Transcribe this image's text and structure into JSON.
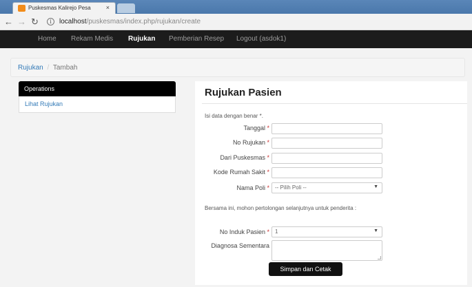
{
  "browser": {
    "tab_title": "Puskesmas Kalirejo Pesa",
    "tab_close": "×",
    "url_info": "i",
    "url_host": "localhost",
    "url_path": "/puskesmas/index.php/rujukan/create"
  },
  "navbar": {
    "items": [
      {
        "label": "Home"
      },
      {
        "label": "Rekam Medis"
      },
      {
        "label": "Rujukan",
        "active": true
      },
      {
        "label": "Pemberian Resep"
      },
      {
        "label": "Logout (asdok1)"
      }
    ]
  },
  "breadcrumb": {
    "link": "Rujukan",
    "separator": "/",
    "current": "Tambah"
  },
  "sidebar": {
    "heading": "Operations",
    "items": [
      {
        "label": "Lihat Rujukan"
      }
    ]
  },
  "form": {
    "title": "Rujukan Pasien",
    "required_note": "Isi data dengan benar *.",
    "required_mark": "*",
    "fields": {
      "tanggal": {
        "label": "Tanggal",
        "value": ""
      },
      "no_rujukan": {
        "label": "No Rujukan",
        "value": ""
      },
      "dari_puskesmas": {
        "label": "Dari Puskesmas",
        "value": ""
      },
      "kode_rumah_sakit": {
        "label": "Kode Rumah Sakit",
        "value": ""
      },
      "nama_poli": {
        "label": "Nama Poli",
        "selected": "-- Pilih Poli --"
      },
      "no_induk_pasien": {
        "label": "No Induk Pasien",
        "selected": "1"
      },
      "diagnosa_sementara": {
        "label": "Diagnosa Sementara",
        "value": ""
      }
    },
    "patient_note": "Bersama ini, mohon pertolongan selanjutnya untuk penderita :",
    "submit_label": "Simpan dan Cetak"
  }
}
